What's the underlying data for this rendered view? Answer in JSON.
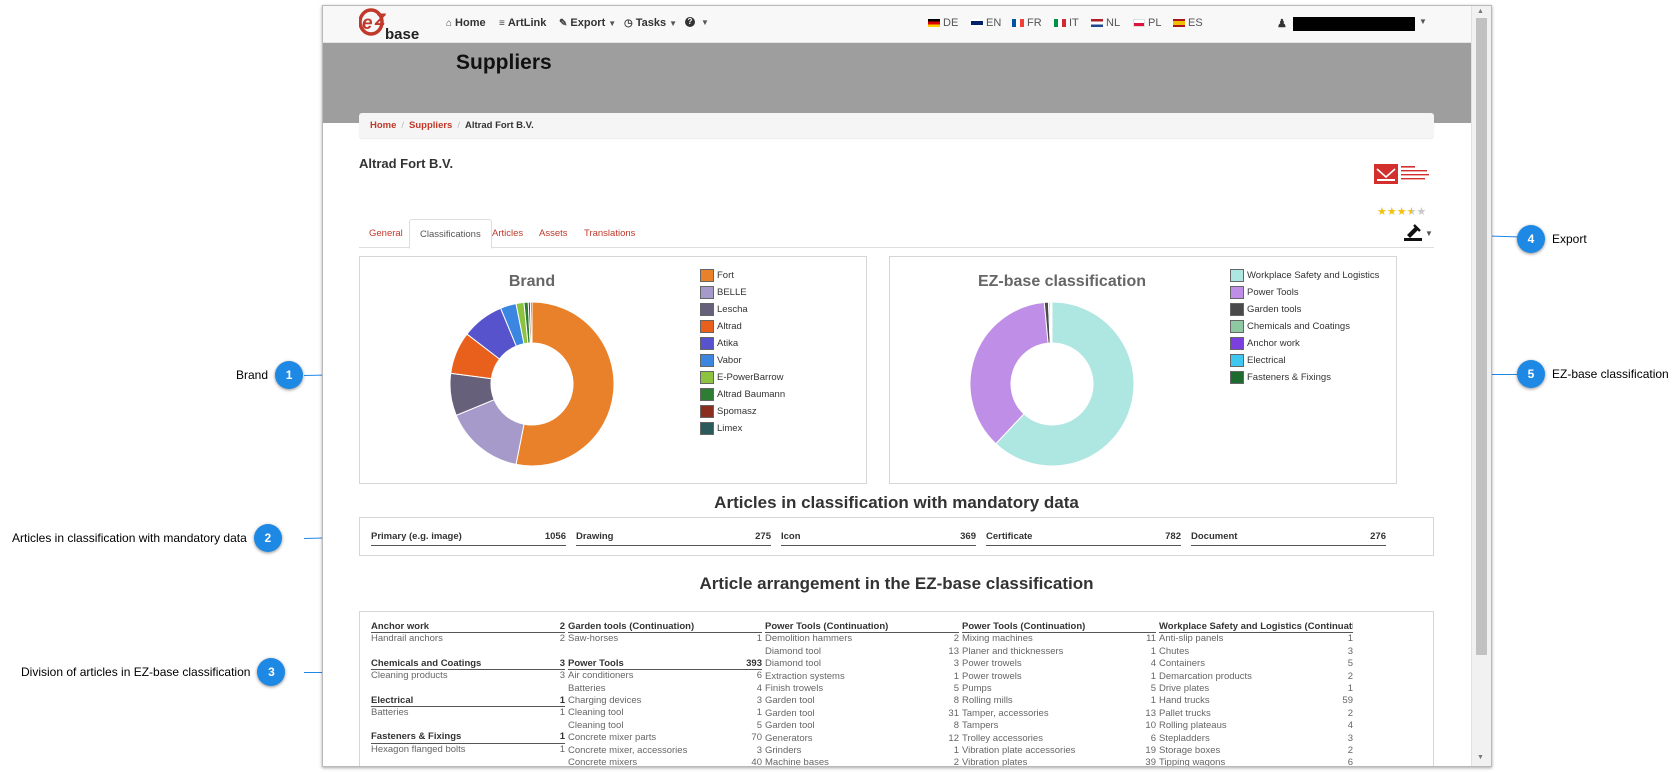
{
  "callouts": {
    "c1": {
      "number": "1",
      "text": "Brand"
    },
    "c2": {
      "number": "2",
      "text": "Articles in classification with mandatory data"
    },
    "c3": {
      "number": "3",
      "text": "Division of articles in EZ-base classification"
    },
    "c4": {
      "number": "4",
      "text": "Export"
    },
    "c5": {
      "number": "5",
      "text": "EZ-base classification"
    }
  },
  "navbar": {
    "logo_text": "base",
    "home": "Home",
    "artlink": "ArtLink",
    "export": "Export",
    "tasks": "Tasks",
    "help": "",
    "languages": [
      "DE",
      "EN",
      "FR",
      "IT",
      "NL",
      "PL",
      "ES"
    ]
  },
  "page": {
    "title": "Suppliers",
    "breadcrumb": [
      "Home",
      "Suppliers",
      "Altrad Fort B.V."
    ],
    "company": "Altrad Fort B.V.",
    "rating": 3.5,
    "rating_max": 5,
    "tabs": [
      "General",
      "Classifications",
      "Articles",
      "Assets",
      "Translations"
    ],
    "active_tab": "Classifications"
  },
  "colors": {
    "accent_red": "#c0392b",
    "callout_blue": "#1e88e5",
    "header_band": "#9e9e9e"
  },
  "chart_data": [
    {
      "type": "pie",
      "title": "Brand",
      "donut": true,
      "legend_position": "right",
      "categories": [
        "Fort",
        "BELLE",
        "Lescha",
        "Altrad",
        "Atika",
        "Vabor",
        "E-PowerBarrow",
        "Altrad Baumann",
        "Spomasz",
        "Limex"
      ],
      "colors": [
        "#e8812a",
        "#a59ac9",
        "#67607a",
        "#e8601c",
        "#5753cd",
        "#3a86e0",
        "#8dc43f",
        "#2e7d32",
        "#8b2d1f",
        "#2b5a5a"
      ],
      "values": [
        51,
        15,
        8,
        8,
        8,
        3,
        1.5,
        0.8,
        0.4,
        0.3
      ]
    },
    {
      "type": "pie",
      "title": "EZ-base classification",
      "donut": true,
      "legend_position": "right",
      "categories": [
        "Workplace Safety and Logistics",
        "Power Tools",
        "Garden tools",
        "Chemicals and Coatings",
        "Anchor work",
        "Electrical",
        "Fasteners & Fixings"
      ],
      "colors": [
        "#aee6e1",
        "#bf8ee6",
        "#4a4a4a",
        "#8ec9a3",
        "#7b3fe0",
        "#3ec8f0",
        "#1e6b2f"
      ],
      "values": [
        62,
        36.5,
        0.8,
        0.3,
        0.2,
        0.1,
        0.1
      ]
    }
  ],
  "mandatory": {
    "title": "Articles in classification with mandatory data",
    "items": [
      {
        "label": "Primary (e.g. image)",
        "value": "1056"
      },
      {
        "label": "Drawing",
        "value": "275"
      },
      {
        "label": "Icon",
        "value": "369"
      },
      {
        "label": "Certificate",
        "value": "782"
      },
      {
        "label": "Document",
        "value": "276"
      }
    ]
  },
  "arrangement": {
    "title": "Article arrangement in the EZ-base classification",
    "columns": [
      [
        {
          "h": true,
          "label": "Anchor work",
          "value": "2"
        },
        {
          "label": "Handrail anchors",
          "value": "2"
        },
        {
          "gap": true
        },
        {
          "h": true,
          "label": "Chemicals and Coatings",
          "value": "3"
        },
        {
          "label": "Cleaning products",
          "value": "3"
        },
        {
          "gap": true
        },
        {
          "h": true,
          "label": "Electrical",
          "value": "1"
        },
        {
          "label": "Batteries",
          "value": "1"
        },
        {
          "gap": true
        },
        {
          "h": true,
          "label": "Fasteners & Fixings",
          "value": "1"
        },
        {
          "label": "Hexagon flanged bolts",
          "value": "1"
        }
      ],
      [
        {
          "h": true,
          "label": "Garden tools (Continuation)",
          "value": ""
        },
        {
          "label": "Saw-horses",
          "value": "1"
        },
        {
          "gap": true
        },
        {
          "h": true,
          "label": "Power Tools",
          "value": "393"
        },
        {
          "label": "Air conditioners",
          "value": "6"
        },
        {
          "label": "Batteries",
          "value": "4"
        },
        {
          "label": "Charging devices",
          "value": "3"
        },
        {
          "label": "Cleaning tool",
          "value": "1"
        },
        {
          "label": "Cleaning tool",
          "value": "5"
        },
        {
          "label": "Concrete mixer parts",
          "value": "70"
        },
        {
          "label": "Concrete mixer, accessories",
          "value": "3"
        },
        {
          "label": "Concrete mixers",
          "value": "40"
        }
      ],
      [
        {
          "h": true,
          "label": "Power Tools (Continuation)",
          "value": ""
        },
        {
          "label": "Demolition hammers",
          "value": "2"
        },
        {
          "label": "Diamond tool",
          "value": "13"
        },
        {
          "label": "Diamond tool",
          "value": "3"
        },
        {
          "label": "Extraction systems",
          "value": "1"
        },
        {
          "label": "Finish trowels",
          "value": "5"
        },
        {
          "label": "Garden tool",
          "value": "8"
        },
        {
          "label": "Garden tool",
          "value": "31"
        },
        {
          "label": "Garden tool",
          "value": "8"
        },
        {
          "label": "Generators",
          "value": "12"
        },
        {
          "label": "Grinders",
          "value": "1"
        },
        {
          "label": "Machine bases",
          "value": "2"
        }
      ],
      [
        {
          "h": true,
          "label": "Power Tools (Continuation)",
          "value": ""
        },
        {
          "label": "Mixing machines",
          "value": "11"
        },
        {
          "label": "Planer and thicknessers",
          "value": "1"
        },
        {
          "label": "Power trowels",
          "value": "4"
        },
        {
          "label": "Power trowels",
          "value": "1"
        },
        {
          "label": "Pumps",
          "value": "5"
        },
        {
          "label": "Rolling mills",
          "value": "1"
        },
        {
          "label": "Tamper, accessories",
          "value": "13"
        },
        {
          "label": "Tampers",
          "value": "10"
        },
        {
          "label": "Trolley accessories",
          "value": "6"
        },
        {
          "label": "Vibration plate accessories",
          "value": "19"
        },
        {
          "label": "Vibration plates",
          "value": "39"
        }
      ],
      [
        {
          "h": true,
          "label": "Workplace Safety and Logistics (Continuati...",
          "value": ""
        },
        {
          "label": "Anti-slip panels",
          "value": "1"
        },
        {
          "label": "Chutes",
          "value": "3"
        },
        {
          "label": "Containers",
          "value": "5"
        },
        {
          "label": "Demarcation products",
          "value": "2"
        },
        {
          "label": "Drive plates",
          "value": "1"
        },
        {
          "label": "Hand trucks",
          "value": "59"
        },
        {
          "label": "Pallet trucks",
          "value": "2"
        },
        {
          "label": "Rolling plateaus",
          "value": "4"
        },
        {
          "label": "Stepladders",
          "value": "3"
        },
        {
          "label": "Storage boxes",
          "value": "2"
        },
        {
          "label": "Tipping wagons",
          "value": "6"
        }
      ]
    ]
  }
}
